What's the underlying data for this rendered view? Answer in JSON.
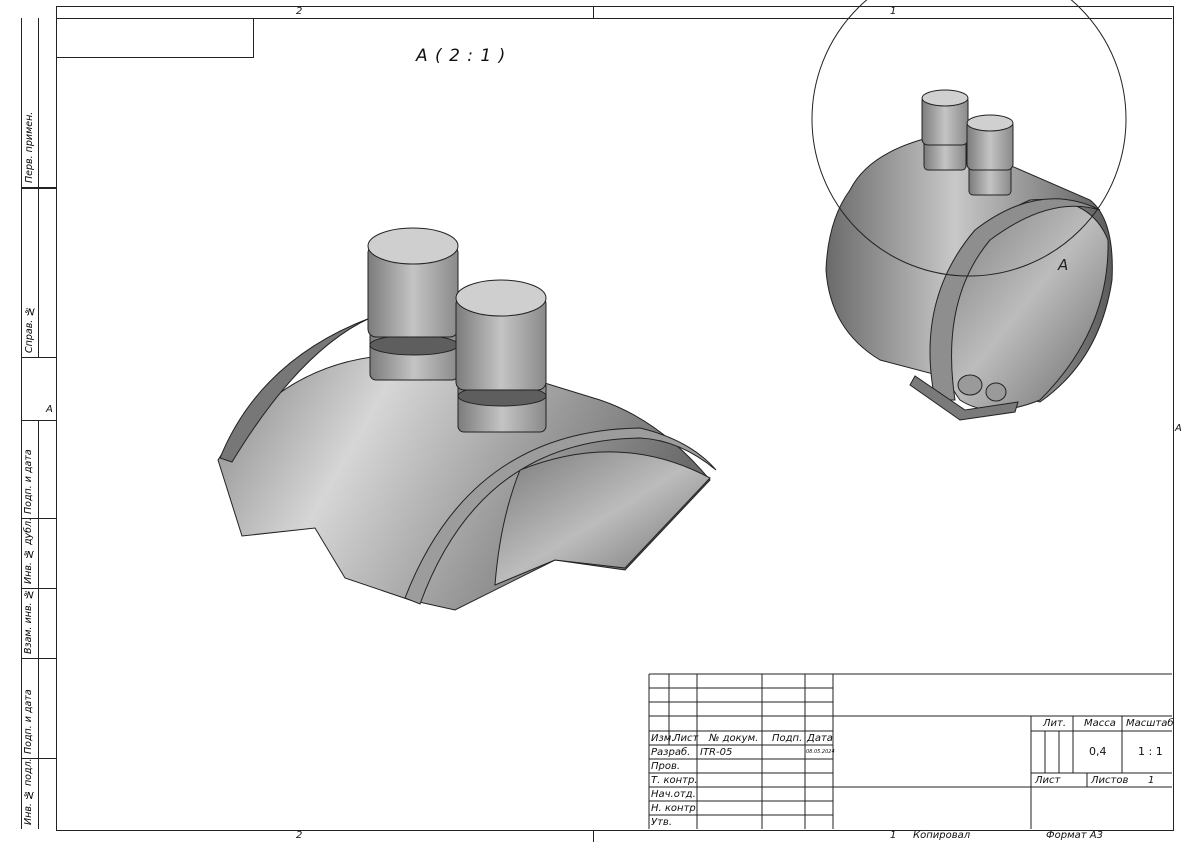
{
  "zones": {
    "top_left": "2",
    "top_right": "1",
    "bottom_left": "2",
    "bottom_right": "1"
  },
  "view": {
    "detail_title": "А ( 2 : 1 )",
    "callout_letter": "А",
    "left_marker": "А",
    "right_marker": "А"
  },
  "side_strip": {
    "perv_primen": "Перв. примен.",
    "sprav": "Справ. №",
    "podp_data_1": "Подп. и дата",
    "inv_dubl": "Инв. № дубл.",
    "vzam_inv": "Взам. инв. №",
    "podp_data_2": "Подп. и дата",
    "inv_podl": "Инв. № подл."
  },
  "title_block": {
    "headers": {
      "izm": "Изм.",
      "list": "Лист",
      "doc_num": "№ докум.",
      "podp": "Подп.",
      "data": "Дата"
    },
    "rows": {
      "razrab": "Разраб.",
      "prov": "Пров.",
      "t_kontr": "Т. контр.",
      "nach_otd": "Нач.отд.",
      "n_kontr": "Н. контр.",
      "utv": "Утв."
    },
    "razrab_name": "ITR-05",
    "razrab_date": "08.05.2024",
    "lit_label": "Лит.",
    "mass_label": "Масса",
    "scale_label": "Масштаб",
    "mass_value": "0,4",
    "scale_value": "1 : 1",
    "sheet_label": "Лист",
    "sheets_label": "Листов",
    "sheets_value": "1"
  },
  "footer": {
    "copied": "Копировал",
    "format": "Формат А3",
    "zone_num": "1"
  }
}
